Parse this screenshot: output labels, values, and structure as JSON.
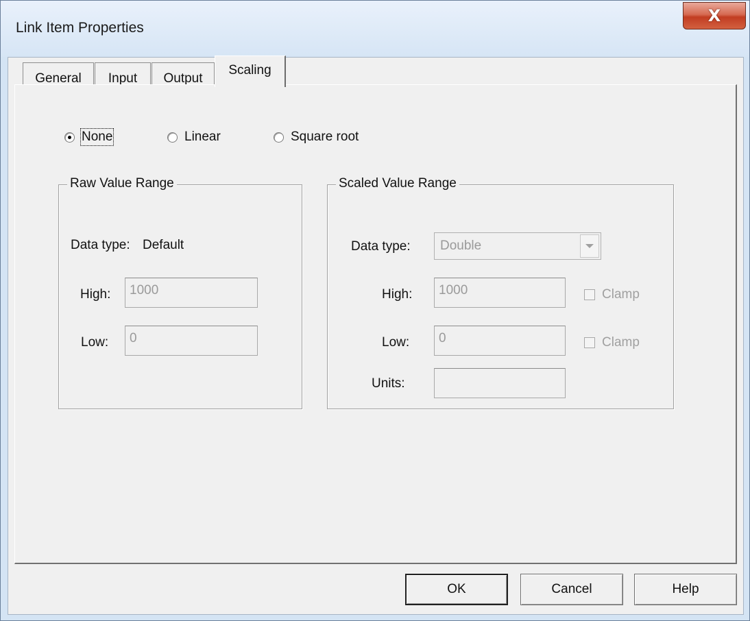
{
  "window": {
    "title": "Link Item Properties",
    "close_label": "X"
  },
  "tabs": [
    {
      "label": "General",
      "active": false
    },
    {
      "label": "Input",
      "active": false
    },
    {
      "label": "Output",
      "active": false
    },
    {
      "label": "Scaling",
      "active": true
    }
  ],
  "scaling": {
    "options": [
      {
        "label": "None",
        "selected": true
      },
      {
        "label": "Linear",
        "selected": false
      },
      {
        "label": "Square root",
        "selected": false
      }
    ]
  },
  "raw_range": {
    "title": "Raw Value Range",
    "data_type_label": "Data type:",
    "data_type_value": "Default",
    "high_label": "High:",
    "high_value": "1000",
    "low_label": "Low:",
    "low_value": "0"
  },
  "scaled_range": {
    "title": "Scaled Value Range",
    "data_type_label": "Data type:",
    "data_type_value": "Double",
    "high_label": "High:",
    "high_value": "1000",
    "low_label": "Low:",
    "low_value": "0",
    "units_label": "Units:",
    "units_value": "",
    "clamp_high_label": "Clamp",
    "clamp_low_label": "Clamp"
  },
  "buttons": {
    "ok": "OK",
    "cancel": "Cancel",
    "help": "Help"
  }
}
